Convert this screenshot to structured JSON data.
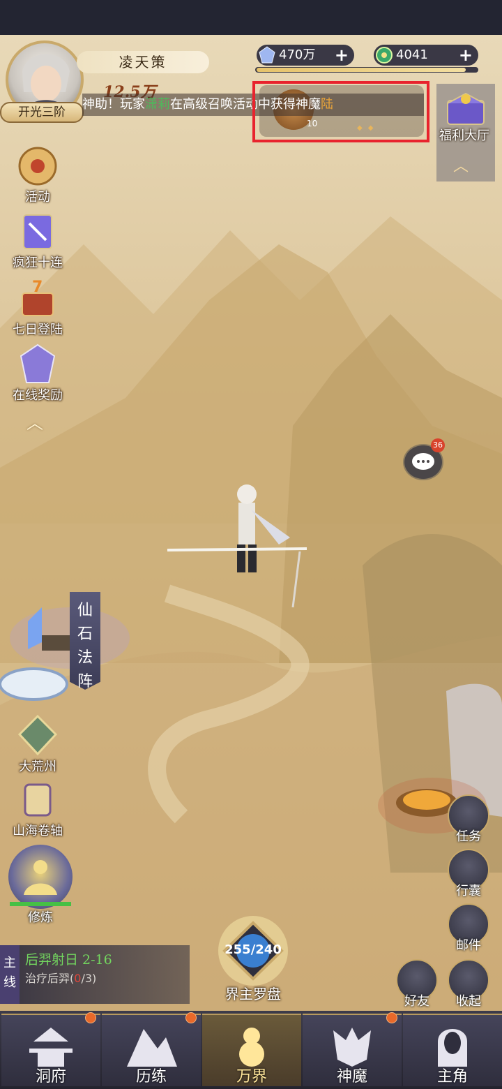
{
  "player": {
    "name": "凌天策",
    "rank": "开光三阶",
    "power": "12.5万"
  },
  "resources": {
    "spirit_stone": "470万",
    "jade": "4041",
    "plus": "+"
  },
  "marquee": {
    "prefix": "神助！玩家",
    "player": "潇莉",
    "middle": "在高级召唤活动中获得神魔",
    "suffix": "陆"
  },
  "promo": {
    "count": "10"
  },
  "right_top": {
    "welfare": "福利大厅"
  },
  "left_menu": [
    "活动",
    "疯狂十连",
    "七日登陆",
    "在线奖励"
  ],
  "left_lower": [
    "大荒州",
    "山海卷轴"
  ],
  "array": {
    "label": "仙石法阵"
  },
  "cultivate": {
    "label": "修炼",
    "progress": 1.0
  },
  "chat": {
    "badge": "36"
  },
  "right_menu": [
    "任务",
    "行囊",
    "邮件"
  ],
  "social": [
    "好友",
    "收起"
  ],
  "quest": {
    "tag": "主线",
    "title": "后羿射日  2-16",
    "desc_prefix": "治疗后羿(",
    "desc_done": "0",
    "desc_suffix": "/3)"
  },
  "compass": {
    "count": "255/240",
    "label": "界主罗盘"
  },
  "bottom_nav": [
    {
      "label": "洞府",
      "badge": true
    },
    {
      "label": "历练",
      "badge": true
    },
    {
      "label": "万界",
      "badge": false,
      "active": true
    },
    {
      "label": "神魔",
      "badge": true
    },
    {
      "label": "主角",
      "badge": false
    }
  ],
  "colors": {
    "accent_gold": "#c9a96a",
    "highlight": "#e8232d",
    "quest_green": "#73d65f"
  }
}
